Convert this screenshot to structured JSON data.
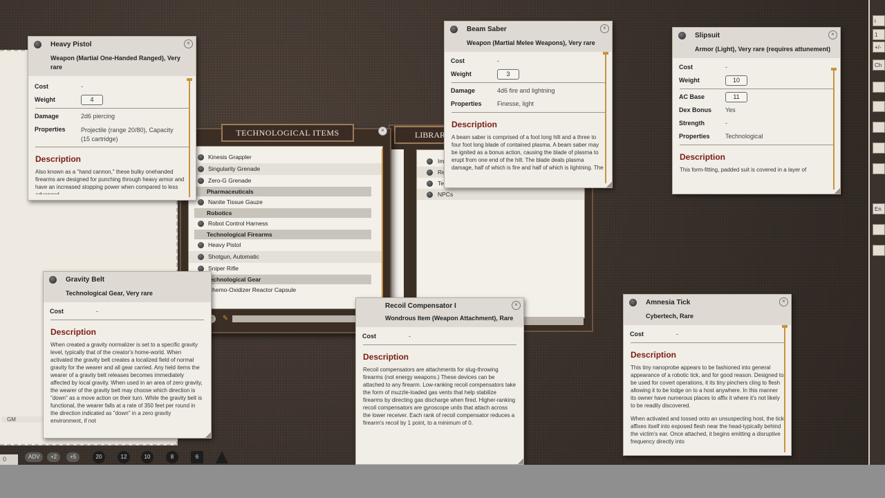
{
  "heavy_pistol": {
    "name": "Heavy Pistol",
    "type": "Weapon (Martial One-Handed Ranged), Very rare",
    "cost_label": "Cost",
    "cost": "-",
    "weight_label": "Weight",
    "weight": "4",
    "damage_label": "Damage",
    "damage": "2d6 piercing",
    "properties_label": "Properties",
    "properties": "Projectile (range 20/80), Capacity (15 cartridge)",
    "desc_header": "Description",
    "desc": "Also known as a \"hand cannon,\" these bulky onehanded firearms are designed for punching through heavy armor and have an increased stopping power when compared to less advanced"
  },
  "beam_saber": {
    "name": "Beam Saber",
    "type": "Weapon (Martial Melee Weapons), Very rare",
    "cost_label": "Cost",
    "cost": "-",
    "weight_label": "Weight",
    "weight": "3",
    "damage_label": "Damage",
    "damage": "4d6 fire and lightning",
    "properties_label": "Properties",
    "properties": "Finesse, light",
    "desc_header": "Description",
    "desc": "A beam saber is comprised of a foot long hilt and a three to four foot long blade of contained plasma. A beam saber may be ignited as a bonus action, causing the blade of plasma to erupt from one end of the hilt. The blade deals plasma damage, half of which is fire and half of which is lightning. The"
  },
  "slipsuit": {
    "name": "Slipsuit",
    "type": "Armor (Light), Very rare (requires attunement)",
    "cost_label": "Cost",
    "cost": "-",
    "weight_label": "Weight",
    "weight": "10",
    "ac_label": "AC Base",
    "ac": "11",
    "dex_label": "Dex Bonus",
    "dex": "Yes",
    "str_label": "Strength",
    "str": "-",
    "properties_label": "Properties",
    "properties": "Technological",
    "desc_header": "Description",
    "desc": "This form-fitting, padded suit is covered in a layer of"
  },
  "gravity_belt": {
    "name": "Gravity Belt",
    "type": "Technological Gear, Very rare",
    "cost_label": "Cost",
    "cost": "-",
    "desc_header": "Description",
    "desc": "When created a gravity normalizer is set to a specific gravity level, typically that of the creator's home-world. When activated the gravity belt creates a localized field of normal gravity for the wearer and all gear carried. Any held items the wearer of a gravity belt releases becomes immediately affected by local gravity. When used in an area of zero gravity, the wearer of the gravity belt may choose which direction is \"down\" as a move action on their turn. While the gravity belt is functional, the wearer falls at a rate of 350 feet per round in the direction indicated as \"down\" in a zero gravity environment, if not"
  },
  "recoil": {
    "name": "Recoil Compensator I",
    "type": "Wondrous Item (Weapon Attachment), Rare",
    "cost_label": "Cost",
    "cost": "-",
    "desc_header": "Description",
    "desc": "Recoil compensators are attachments for slug-throwing firearms (not energy weapons.) These devices can be attached to any firearm. Low-ranking recoil compensators take the form of muzzle-loaded gas vents that help stabilize firearms by directing gas discharge when fired. Higher-ranking recoil compensators are gyroscope units that attach across the lower receiver. Each rank of recoil compensator reduces a firearm's recoil by 1 point, to a minimum of 0."
  },
  "amnesia": {
    "name": "Amnesia Tick",
    "type": "Cybertech, Rare",
    "cost_label": "Cost",
    "cost": "-",
    "desc_header": "Description",
    "desc1": "This tiny nanoprobe appears to be fashioned into general appearance of a robotic tick, and for good reason. Designed to be used for covert operations, it its tiny pinchers cling to flesh allowing it to be lodge on to a host anywhere. In this manner its owner have numerous places to affix it where it's not likely to be readily discovered.",
    "desc2": "When activated and tossed onto an unsuspecting host, the tick affixes itself into exposed flesh near the head-typically behind the victim's ear. Once attached, it begins emitting a disruptive frequency directly into"
  },
  "tech_items": {
    "title": "TECHNOLOGICAL ITEMS",
    "items": [
      {
        "kind": "item",
        "label": "Kinesis Grappler"
      },
      {
        "kind": "item",
        "label": "Singularity Grenade"
      },
      {
        "kind": "item",
        "label": "Zero-G Grenade"
      },
      {
        "kind": "group",
        "label": "Pharmaceuticals"
      },
      {
        "kind": "item",
        "label": "Nanite Tissue Gauze"
      },
      {
        "kind": "group",
        "label": "Robotics"
      },
      {
        "kind": "item",
        "label": "Robot Control Harness"
      },
      {
        "kind": "group",
        "label": "Technological Firearms"
      },
      {
        "kind": "item",
        "label": "Heavy Pistol"
      },
      {
        "kind": "item",
        "label": "Shotgun, Automatic"
      },
      {
        "kind": "item",
        "label": "Sniper Rifle"
      },
      {
        "kind": "group",
        "label": "Technological Gear"
      },
      {
        "kind": "item",
        "label": "Chemo-Oxidizer Reactor Capsule"
      }
    ]
  },
  "library": {
    "title": "LIBRARY",
    "items": [
      "Im",
      "Re",
      "Te",
      "NPCs"
    ],
    "left_fragments": [
      "id",
      "e"
    ]
  },
  "gm_label": "GM",
  "left_number": "0",
  "dice_pills": [
    "ADV",
    "+2",
    "+5"
  ],
  "dice": [
    "20",
    "12",
    "10",
    "8",
    "6",
    ""
  ],
  "rail_buttons": [
    "i",
    "1",
    "+/-",
    "Ch",
    "",
    "",
    "",
    "",
    "",
    "En",
    "",
    ""
  ]
}
